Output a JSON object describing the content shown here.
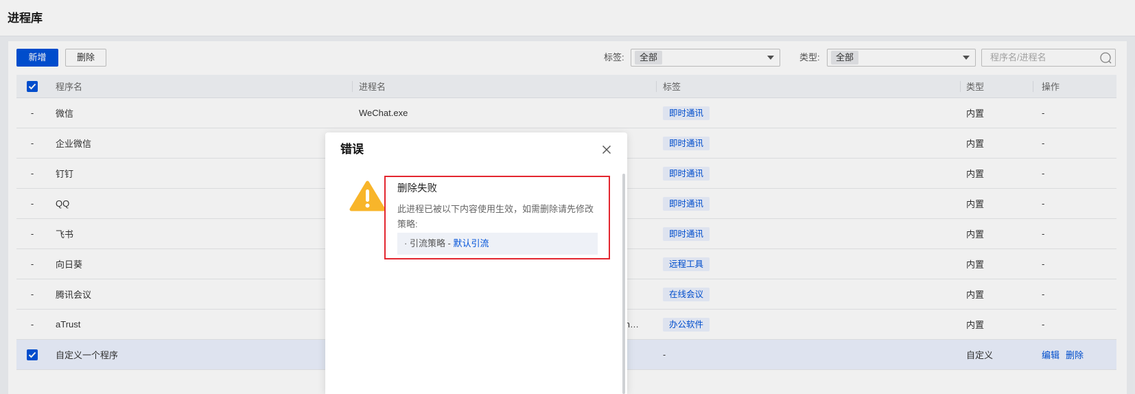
{
  "page": {
    "title": "进程库"
  },
  "toolbar": {
    "add_label": "新增",
    "delete_label": "删除"
  },
  "filters": {
    "tag_label": "标签:",
    "tag_value": "全部",
    "type_label": "类型:",
    "type_value": "全部",
    "search_placeholder": "程序名/进程名"
  },
  "table": {
    "columns": [
      "程序名",
      "进程名",
      "标签",
      "类型",
      "操作"
    ],
    "header_checked": true,
    "rows": [
      {
        "selector": "-",
        "name": "微信",
        "process": "WeChat.exe",
        "tag": "即时通讯",
        "type": "内置",
        "actions": "-"
      },
      {
        "selector": "-",
        "name": "企业微信",
        "tag": "即时通讯",
        "type": "内置",
        "actions": "-"
      },
      {
        "selector": "-",
        "name": "钉钉",
        "tag": "即时通讯",
        "type": "内置",
        "actions": "-"
      },
      {
        "selector": "-",
        "name": "QQ",
        "tag": "即时通讯",
        "type": "内置",
        "actions": "-"
      },
      {
        "selector": "-",
        "name": "飞书",
        "tag": "即时通讯",
        "type": "内置",
        "actions": "-"
      },
      {
        "selector": "-",
        "name": "向日葵",
        "tag": "远程工具",
        "type": "内置",
        "actions": "-"
      },
      {
        "selector": "-",
        "name": "腾讯会议",
        "tag": "在线会议",
        "type": "内置",
        "actions": "-"
      },
      {
        "selector": "-",
        "name": "aTrust",
        "process": "m…",
        "tag": "办公软件",
        "type": "内置",
        "actions": "-"
      },
      {
        "checked": true,
        "name": "自定义一个程序",
        "tag": "-",
        "type": "自定义",
        "actions": {
          "edit": "编辑",
          "delete": "删除"
        }
      }
    ]
  },
  "dialog": {
    "title": "错误",
    "heading": "删除失败",
    "message": "此进程已被以下内容使用生效，如需删除请先修改策略:",
    "reference_prefix": "· 引流策略 - ",
    "reference_link": "默认引流"
  },
  "icons": {
    "close": "close-icon",
    "warning": "warning-icon",
    "search": "search-icon",
    "dropdown": "chevron-down-icon",
    "check": "check-icon"
  },
  "colors": {
    "accent": "#0052d9",
    "tag_bg": "#ecf2fe",
    "warning": "#f8b52a",
    "annotation": "#e3262f",
    "selected_row": "#ecf2fe"
  }
}
